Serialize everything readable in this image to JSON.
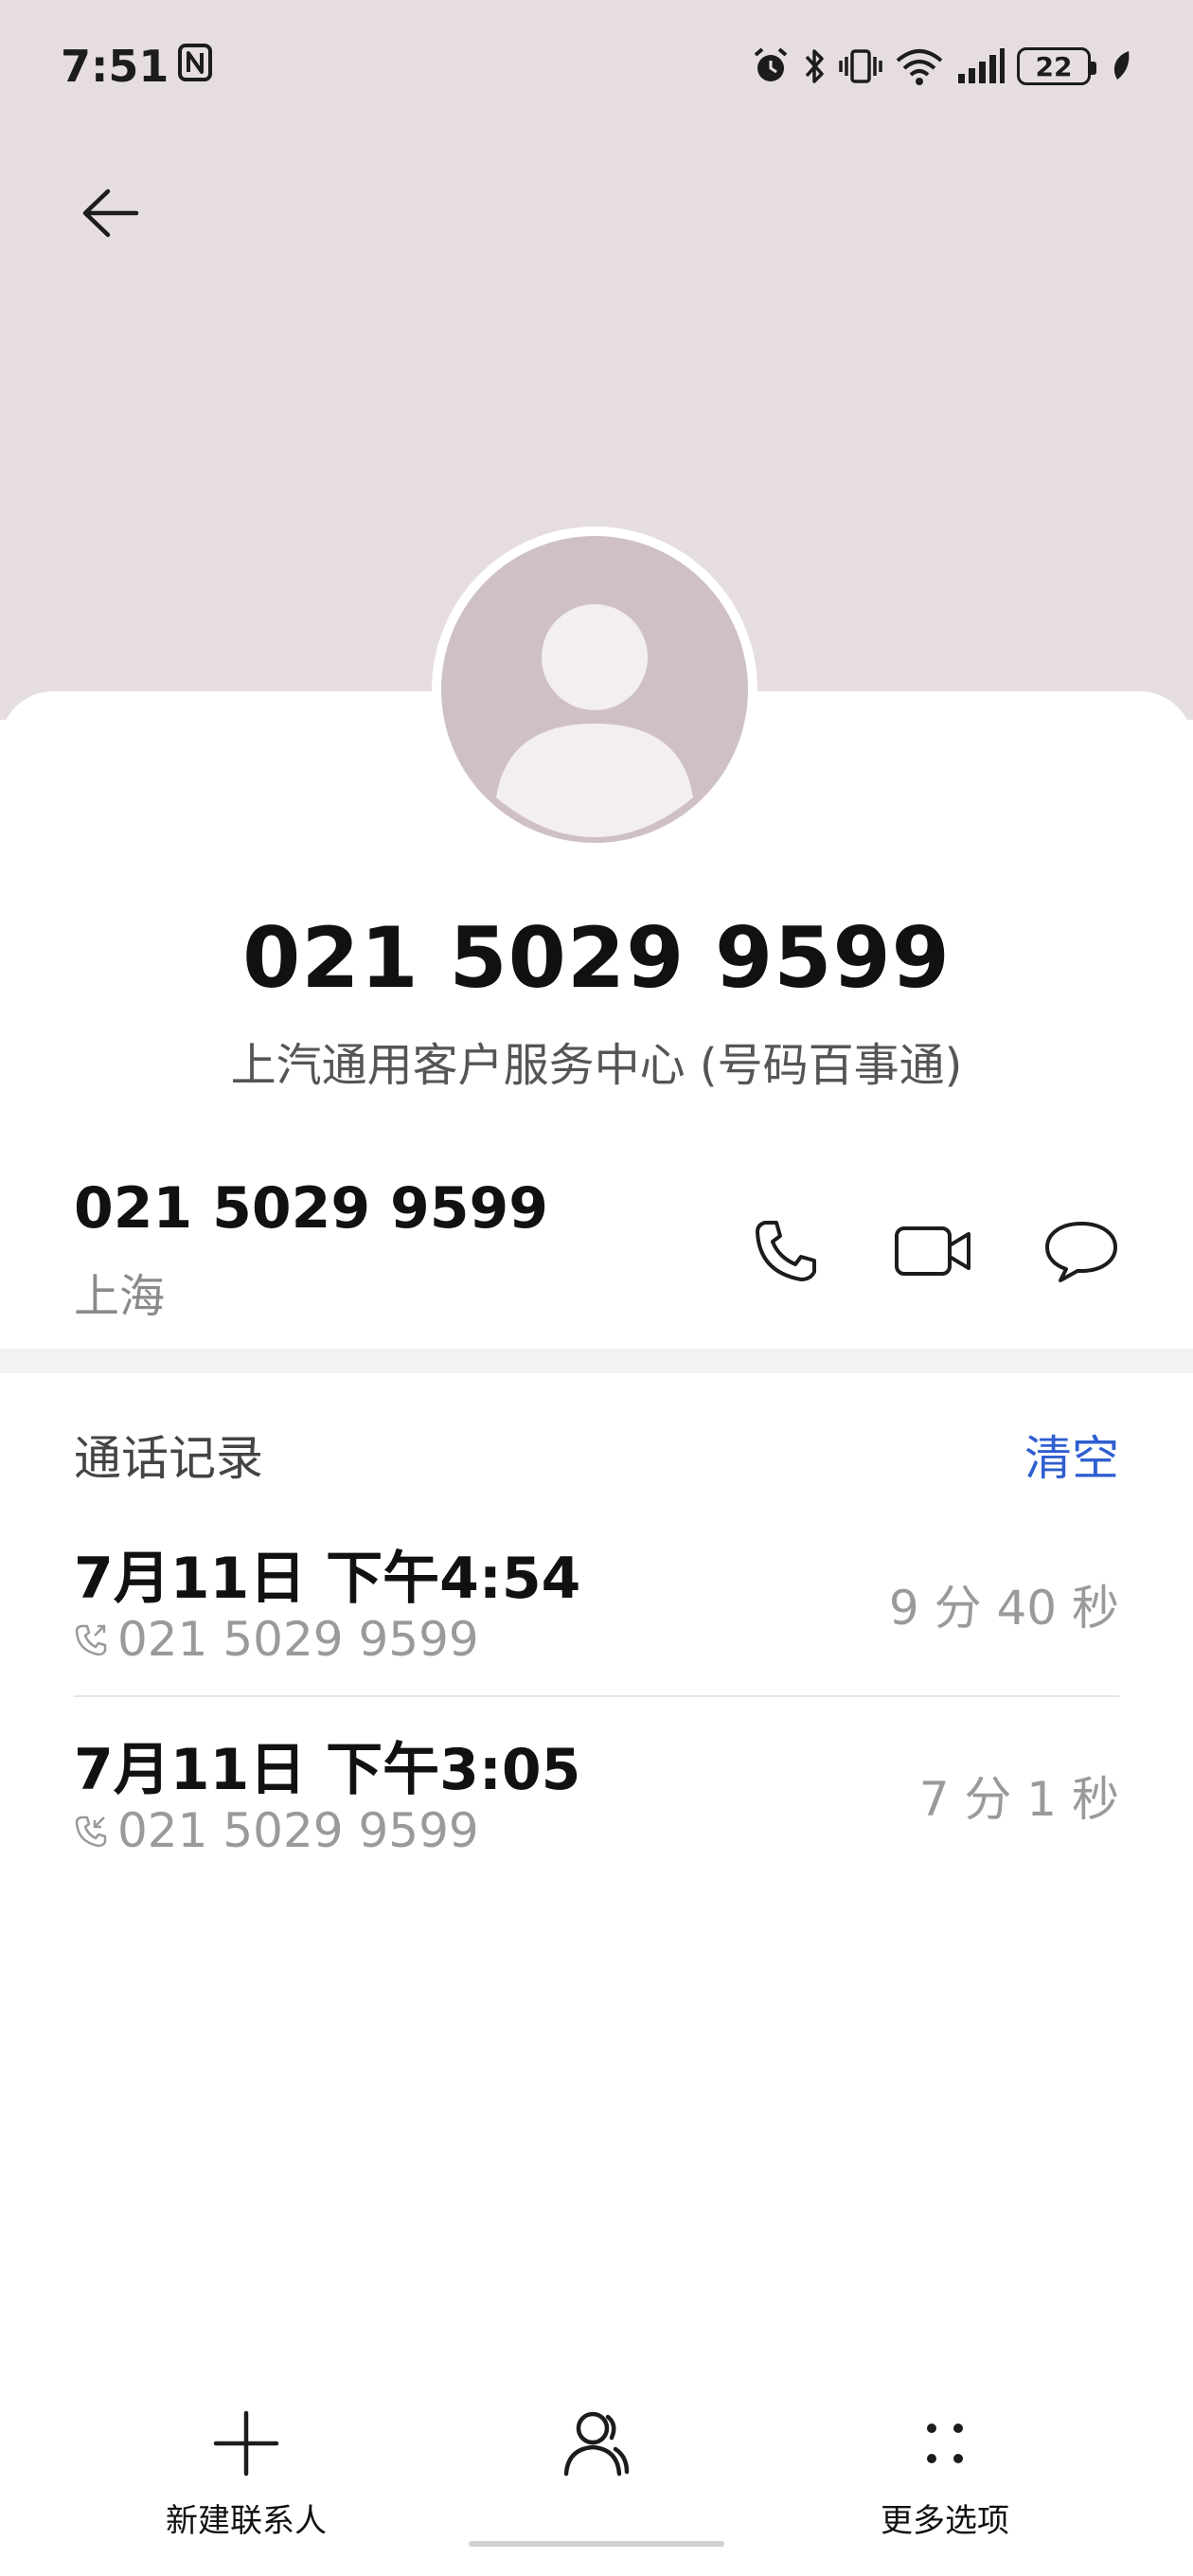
{
  "status_bar": {
    "time": "7:51",
    "battery": "22"
  },
  "contact": {
    "number": "021 5029 9599",
    "subtitle": "上汽通用客户服务中心 (号码百事通)"
  },
  "number_row": {
    "number": "021 5029 9599",
    "location": "上海"
  },
  "call_history": {
    "title": "通话记录",
    "clear_label": "清空",
    "items": [
      {
        "when": "7月11日 下午4:54",
        "number": "021 5029 9599",
        "duration": "9 分 40 秒",
        "direction": "outgoing"
      },
      {
        "when": "7月11日 下午3:05",
        "number": "021 5029 9599",
        "duration": "7 分 1 秒",
        "direction": "incoming"
      }
    ]
  },
  "bottom_bar": {
    "new_contact": "新建联系人",
    "more_options": "更多选项"
  },
  "colors": {
    "header_bg": "#e6dde3",
    "avatar_bg": "#cfc0c8",
    "accent": "#2f5fd0"
  },
  "icons": [
    "nfc-icon",
    "alarm-icon",
    "bluetooth-icon",
    "vibrate-icon",
    "wifi-icon",
    "signal-icon",
    "leaf-icon",
    "back-arrow-icon",
    "phone-icon",
    "video-call-icon",
    "message-icon",
    "outgoing-call-icon",
    "incoming-call-icon",
    "plus-icon",
    "person-icon",
    "more-dots-icon"
  ]
}
